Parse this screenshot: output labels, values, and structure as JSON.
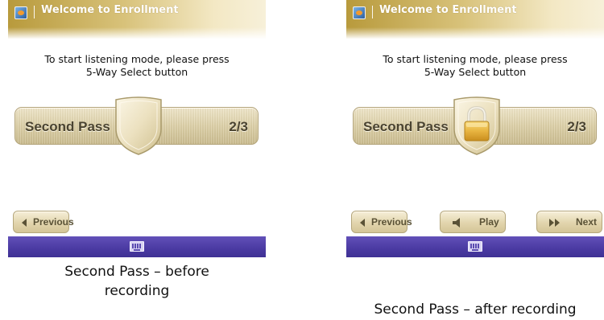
{
  "screens": [
    {
      "title": "Welcome to Enrollment",
      "instructions": [
        "To start listening mode, please press",
        "5-Way Select button"
      ],
      "pass_label": "Second Pass",
      "pass_count": "2/3",
      "shield_icon": "shield-icon",
      "buttons": {
        "previous": "Previous"
      },
      "softkey_icon": "keyboard-icon",
      "caption": [
        "Second Pass – before",
        "recording"
      ]
    },
    {
      "title": "Welcome to Enrollment",
      "instructions": [
        "To start listening mode, please press",
        "5-Way Select button"
      ],
      "pass_label": "Second Pass",
      "pass_count": "2/3",
      "shield_icon": "lock-icon",
      "buttons": {
        "previous": "Previous",
        "play": "Play",
        "next": "Next"
      },
      "softkey_icon": "keyboard-icon",
      "caption": "Second Pass – after recording"
    }
  ],
  "colors": {
    "title_gold": "#b89a3c",
    "softbar_purple": "#4a3aa2",
    "lock_gold": "#e8b440"
  }
}
